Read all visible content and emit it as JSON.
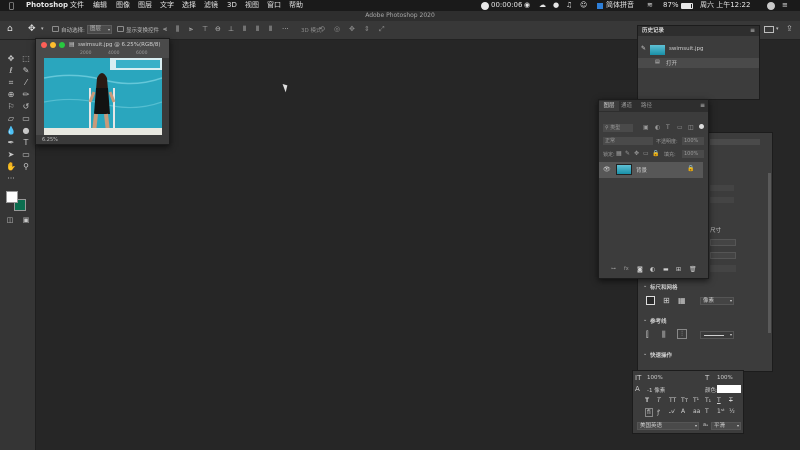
{
  "menubar": {
    "app_name": "Photoshop",
    "menus": [
      "文件",
      "编辑",
      "图像",
      "图层",
      "文字",
      "选择",
      "滤镜",
      "3D",
      "视图",
      "窗口",
      "帮助"
    ],
    "status": {
      "timer": "00:00:06",
      "battery": "87%",
      "input_method": "简体拼音",
      "clock": "周六 上午12:22"
    }
  },
  "window_title": "Adobe Photoshop 2020",
  "options_bar": {
    "auto_select_label": "自动选择:",
    "auto_select_value": "图层",
    "show_transform_label": "显示变换控件",
    "mode_3d": "3D 模式:"
  },
  "document": {
    "title": "swimsuit.jpg @ 6.25%(RGB/8)",
    "ruler_ticks": [
      "2000",
      "4000",
      "6000"
    ],
    "zoom": "6.25%"
  },
  "history_panel": {
    "title": "历史记录",
    "snapshot_name": "swimsuit.jpg",
    "steps": [
      "打开"
    ]
  },
  "layers_panel": {
    "tabs": [
      "图层",
      "通道",
      "路径"
    ],
    "filter_label": "类型",
    "blend_mode": "正常",
    "opacity_label": "不透明度:",
    "opacity_value": "100%",
    "lock_label": "锁定:",
    "fill_label": "填充:",
    "fill_value": "100%",
    "layer_name": "背景"
  },
  "properties_panel": {
    "partial_label": "尺寸",
    "rulers_grids_title": "标尺和网格",
    "unit_value": "像素",
    "guides_title": "参考线",
    "quick_actions_title": "快速操作"
  },
  "character_panel": {
    "vertical_scale": "100%",
    "horizontal_scale": "100%",
    "baseline_shift": "-1 像素",
    "color_label": "颜色:",
    "language": "美国英语",
    "anti_alias": "平滑"
  },
  "colors": {
    "foreground": "#ffffff",
    "background": "#0b6e4f",
    "accent": "#2e7fd8"
  }
}
